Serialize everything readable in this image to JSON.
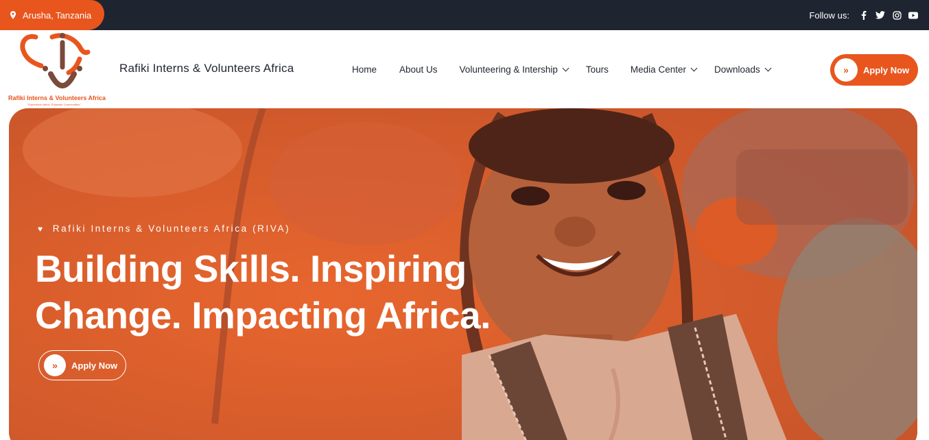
{
  "topbar": {
    "location": "Arusha, Tanzania",
    "follow_label": "Follow us:",
    "socials": [
      "facebook-icon",
      "twitter-icon",
      "instagram-icon",
      "youtube-icon"
    ]
  },
  "header": {
    "logo_brand": "Rafiki Interns & Volunteers Africa",
    "logo_tagline": "\"Experience Africa. Empower Communities.\"",
    "site_title": "Rafiki Interns & Volunteers Africa",
    "nav": [
      {
        "label": "Home",
        "dropdown": false
      },
      {
        "label": "About Us",
        "dropdown": false
      },
      {
        "label": "Volunteering & Intership",
        "dropdown": true
      },
      {
        "label": "Tours",
        "dropdown": false
      },
      {
        "label": "Media Center",
        "dropdown": true
      },
      {
        "label": "Downloads",
        "dropdown": true
      }
    ],
    "apply_label": "Apply Now"
  },
  "hero": {
    "eyebrow": "Rafiki Interns & Volunteers Africa (RIVA)",
    "headline_line1": "Building Skills. Inspiring",
    "headline_line2": "Change. Impacting Africa.",
    "apply_label": "Apply Now"
  },
  "colors": {
    "accent": "#e8561e",
    "dark": "#1f2530",
    "white": "#ffffff"
  }
}
